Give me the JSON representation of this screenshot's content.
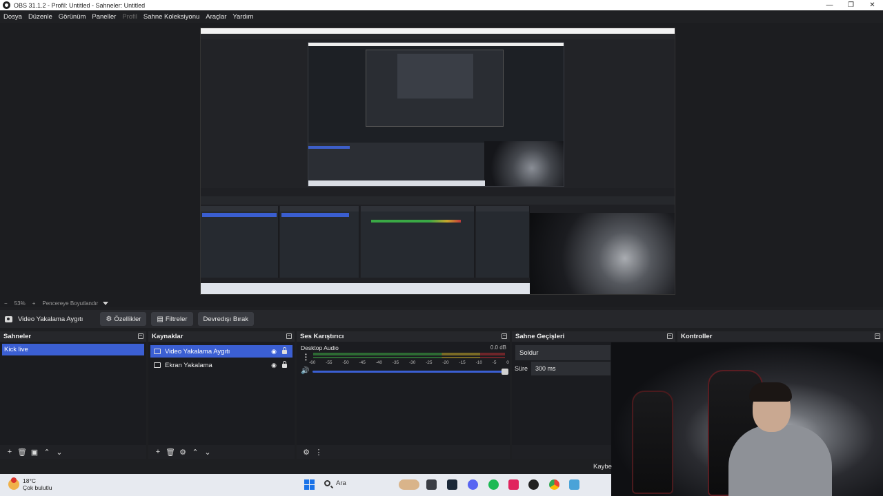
{
  "window": {
    "title": "OBS 31.1.2 - Profil: Untitled - Sahneler: Untitled",
    "controls": [
      "—",
      "❐",
      "✕"
    ]
  },
  "menu": [
    {
      "label": "Dosya",
      "disabled": false
    },
    {
      "label": "Düzenle",
      "disabled": false
    },
    {
      "label": "Görünüm",
      "disabled": false
    },
    {
      "label": "Paneller",
      "disabled": false
    },
    {
      "label": "Profil",
      "disabled": true
    },
    {
      "label": "Sahne Koleksiyonu",
      "disabled": false
    },
    {
      "label": "Araçlar",
      "disabled": false
    },
    {
      "label": "Yardım",
      "disabled": false
    }
  ],
  "zoom": {
    "minus": "−",
    "value": "53%",
    "plus": "+",
    "fit_label": "Pencereye Boyutlandır"
  },
  "source_toolbar": {
    "source_name": "Video Yakalama Aygıtı",
    "properties": "Özellikler",
    "filters": "Filtreler",
    "deactivate": "Devredışı Bırak"
  },
  "scenes": {
    "title": "Sahneler",
    "items": [
      "Kick live"
    ]
  },
  "sources": {
    "title": "Kaynaklar",
    "items": [
      {
        "label": "Video Yakalama Aygıtı",
        "selected": true
      },
      {
        "label": "Ekran Yakalama",
        "selected": false
      }
    ]
  },
  "mixer": {
    "title": "Ses Karıştırıcı",
    "channel": "Desktop Audio",
    "db": "0.0 dB",
    "scale": [
      "-60",
      "-55",
      "-50",
      "-45",
      "-40",
      "-35",
      "-30",
      "-25",
      "-20",
      "-15",
      "-10",
      "-5",
      "0"
    ],
    "volume_level": 1.0
  },
  "transitions": {
    "title": "Sahne Geçişleri",
    "type": "Soldur",
    "duration_label": "Süre",
    "duration_value": "300 ms"
  },
  "controls": {
    "title": "Kontroller"
  },
  "footer_icons": {
    "scenes": [
      "+",
      "🗑",
      "▣",
      "⌃",
      "⌄"
    ],
    "sources": [
      "+",
      "🗑",
      "⚙",
      "⌃",
      "⌄"
    ],
    "mixer": [
      "⚙",
      "⋮"
    ]
  },
  "bottom_text": "Kaybe",
  "taskbar": {
    "temp": "18°C",
    "condition": "Çok bulutlu",
    "search": "Ara"
  },
  "colors": {
    "accent": "#3b5fd3",
    "panel": "#1f2024",
    "bg": "#1e1f22"
  }
}
